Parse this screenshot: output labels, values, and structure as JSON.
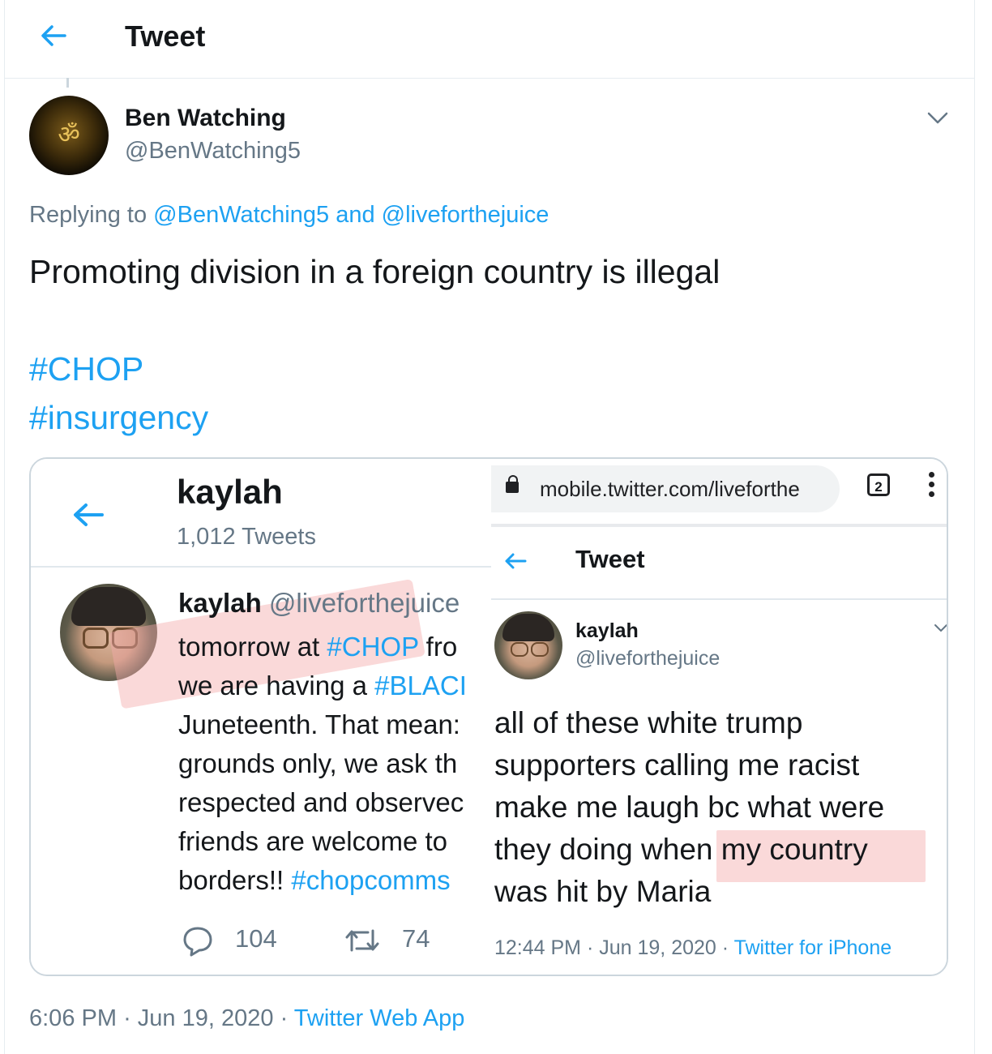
{
  "header": {
    "title": "Tweet"
  },
  "tweet": {
    "author_name": "Ben Watching",
    "author_handle": "@BenWatching5",
    "avatar_symbol": "ॐ",
    "replying_prefix": "Replying to",
    "replying_user1": "@BenWatching5",
    "replying_and": "and",
    "replying_user2": "@liveforthejuice",
    "text": "Promoting division in a foreign country is illegal",
    "hashtags": [
      "#CHOP",
      "#insurgency"
    ],
    "time": "6:06 PM",
    "date": "Jun 19, 2020",
    "source": "Twitter Web App",
    "separator": "·"
  },
  "embedded_left": {
    "profile_name": "kaylah",
    "tweet_count": "1,012 Tweets",
    "author_name": "kaylah",
    "author_handle": "@liveforthejuice",
    "lines": [
      [
        "tomorrow at ",
        "#CHOP",
        " fro"
      ],
      [
        "we are having a ",
        "#BLACI",
        ""
      ],
      [
        "Juneteenth. That mean:",
        "",
        ""
      ],
      [
        "grounds only, we ask th",
        "",
        ""
      ],
      [
        "respected and observec",
        "",
        ""
      ],
      [
        "friends are welcome to",
        "",
        ""
      ],
      [
        "borders!! ",
        "#chopcomms",
        ""
      ]
    ],
    "replies": "104",
    "retweets": "74"
  },
  "embedded_right": {
    "url": "mobile.twitter.com/liveforthe",
    "tab_count": "2",
    "header_title": "Tweet",
    "author_name": "kaylah",
    "author_handle": "@liveforthejuice",
    "lines": [
      "all of these white trump",
      "supporters calling me racist",
      "make me laugh bc what were",
      "they doing when my country",
      "was hit by Maria"
    ],
    "time": "12:44 PM",
    "date": "Jun 19, 2020",
    "source": "Twitter for iPhone",
    "separator": "·"
  },
  "colors": {
    "link": "#1da1f2",
    "secondary_text": "#657786",
    "highlight": "#f4aaaa"
  }
}
